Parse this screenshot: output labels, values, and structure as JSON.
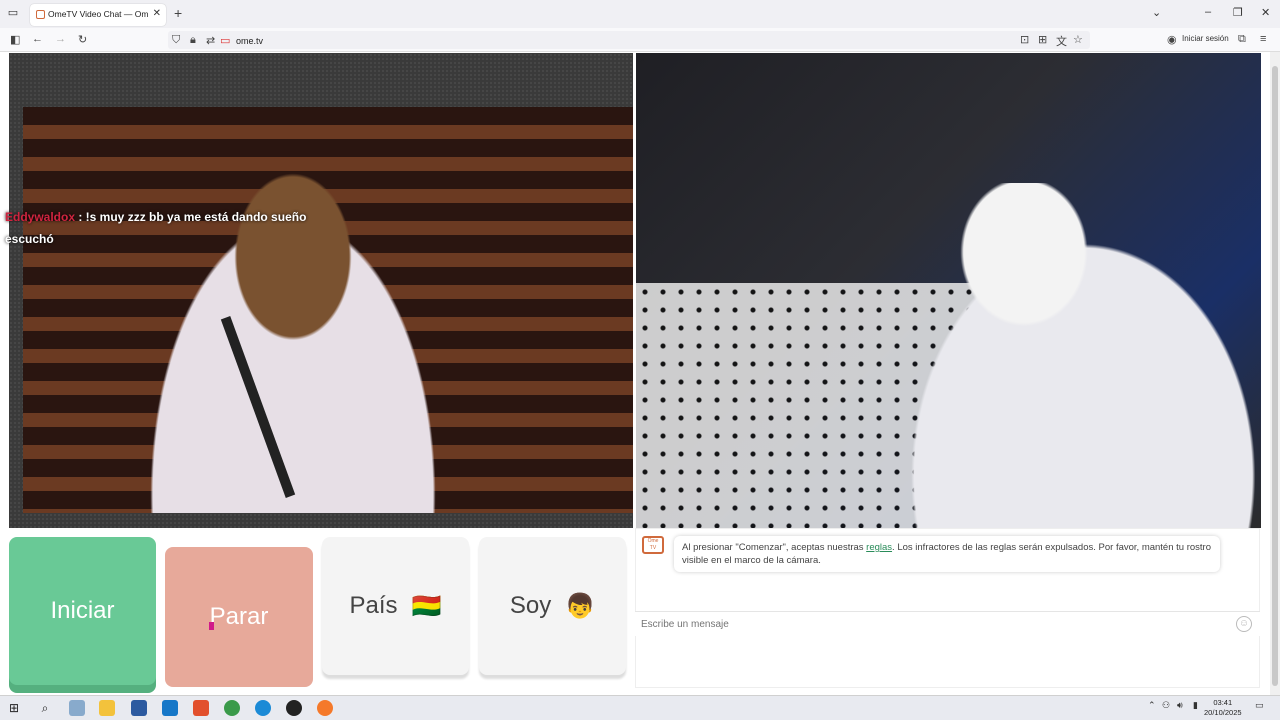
{
  "browser": {
    "tab_title": "OmeTV Video Chat — Omegle",
    "new_tab": "+",
    "url": "ome.tv",
    "sign_in": "Iniciar sesión"
  },
  "chat_overlay": [
    {
      "user": "Eddywaldox",
      "text": " : !s muy zzz bb ya me está dando sueño"
    },
    {
      "user": "",
      "text": "escuchó"
    }
  ],
  "buttons": {
    "start": "Iniciar",
    "stop": "Parar",
    "country": "País",
    "country_flag": "🇧🇴",
    "gender": "Soy",
    "gender_emoji": "👦"
  },
  "chat": {
    "bot_icon_text": "Ome TV",
    "message_pre": "Al presionar \"Comenzar\", aceptas nuestras ",
    "message_link": "reglas",
    "message_post": ". Los infractores de las reglas serán expulsados. Por favor, mantén tu rostro visible en el marco de la cámara.",
    "input_placeholder": "Escribe un mensaje"
  },
  "taskbar": {
    "time": "03:41",
    "date": "20/10/2025"
  },
  "colors": {
    "start": "#69c996",
    "stop": "#e7a99a",
    "neutral": "#f4f4f4",
    "username": "#d0243f"
  }
}
